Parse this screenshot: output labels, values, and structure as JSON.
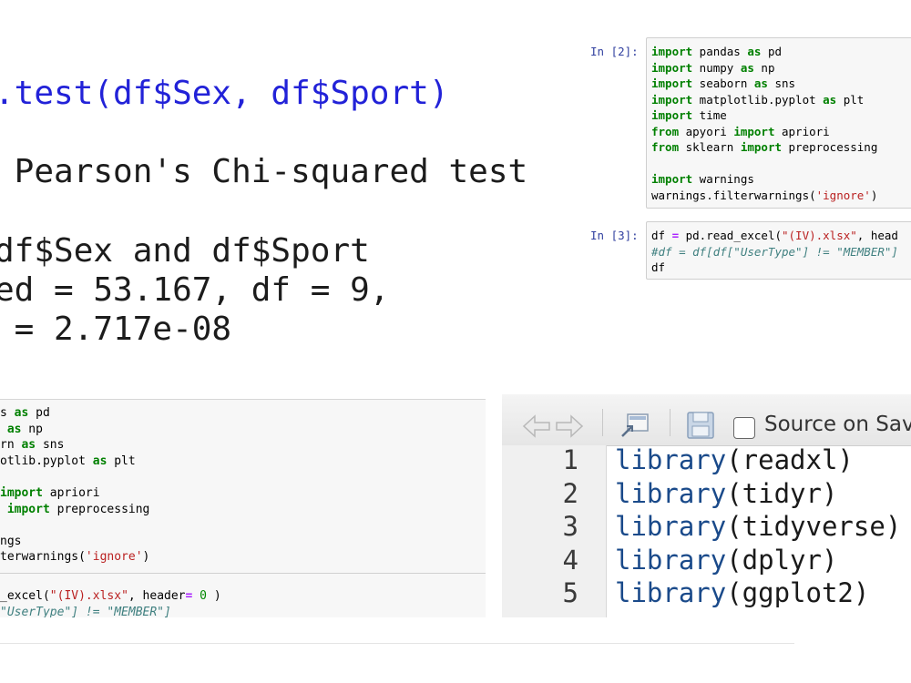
{
  "r_console": {
    "command": ".test(df$Sex, df$Sport)",
    "title": " Pearson's Chi-squared test",
    "data_line": "df$Sex and df$Sport",
    "stat_line": "ed = 53.167, df = 9,",
    "p_line": " = 2.717e-08"
  },
  "notebook_top": {
    "cell1_prompt": "In [2]:",
    "cell2_prompt": "In [3]:",
    "cell1_lines": [
      [
        [
          "kw",
          "import"
        ],
        [
          "t",
          " pandas "
        ],
        [
          "kw",
          "as"
        ],
        [
          "t",
          " pd"
        ]
      ],
      [
        [
          "kw",
          "import"
        ],
        [
          "t",
          " numpy "
        ],
        [
          "kw",
          "as"
        ],
        [
          "t",
          " np"
        ]
      ],
      [
        [
          "kw",
          "import"
        ],
        [
          "t",
          " seaborn "
        ],
        [
          "kw",
          "as"
        ],
        [
          "t",
          " sns"
        ]
      ],
      [
        [
          "kw",
          "import"
        ],
        [
          "t",
          " matplotlib.pyplot "
        ],
        [
          "kw",
          "as"
        ],
        [
          "t",
          " plt"
        ]
      ],
      [
        [
          "kw",
          "import"
        ],
        [
          "t",
          " time"
        ]
      ],
      [
        [
          "kw",
          "from"
        ],
        [
          "t",
          " apyori "
        ],
        [
          "kw",
          "import"
        ],
        [
          "t",
          " apriori"
        ]
      ],
      [
        [
          "kw",
          "from"
        ],
        [
          "t",
          " sklearn "
        ],
        [
          "kw",
          "import"
        ],
        [
          "t",
          " preprocessing"
        ]
      ],
      [
        [
          "t",
          ""
        ]
      ],
      [
        [
          "kw",
          "import"
        ],
        [
          "t",
          " warnings"
        ]
      ],
      [
        [
          "t",
          "warnings.filterwarnings("
        ],
        [
          "str",
          "'ignore'"
        ],
        [
          "t",
          ")"
        ]
      ]
    ],
    "cell2_lines": [
      [
        [
          "t",
          "df "
        ],
        [
          "op",
          "="
        ],
        [
          "t",
          " pd.read_excel("
        ],
        [
          "str",
          "\"(IV).xlsx\""
        ],
        [
          "t",
          ", head"
        ]
      ],
      [
        [
          "cmt",
          "#df = df[df[\"UserType\"] != \"MEMBER\"]"
        ]
      ],
      [
        [
          "t",
          "df"
        ]
      ]
    ]
  },
  "notebook_bottom": {
    "lines": [
      [
        [
          "t",
          "s "
        ],
        [
          "kw",
          "as"
        ],
        [
          "t",
          " pd"
        ]
      ],
      [
        [
          "t",
          " "
        ],
        [
          "kw",
          "as"
        ],
        [
          "t",
          " np"
        ]
      ],
      [
        [
          "t",
          "rn "
        ],
        [
          "kw",
          "as"
        ],
        [
          "t",
          " sns"
        ]
      ],
      [
        [
          "t",
          "otlib.pyplot "
        ],
        [
          "kw",
          "as"
        ],
        [
          "t",
          " plt"
        ]
      ],
      [
        [
          "t",
          ""
        ]
      ],
      [
        [
          "kw",
          "import"
        ],
        [
          "t",
          " apriori"
        ]
      ],
      [
        [
          "t",
          " "
        ],
        [
          "kw",
          "import"
        ],
        [
          "t",
          " preprocessing"
        ]
      ],
      [
        [
          "t",
          ""
        ]
      ],
      [
        [
          "t",
          "ngs"
        ]
      ],
      [
        [
          "t",
          "terwarnings("
        ],
        [
          "str",
          "'ignore'"
        ],
        [
          "t",
          ")"
        ]
      ]
    ],
    "lines2": [
      [
        [
          "t",
          "_excel("
        ],
        [
          "str",
          "\"(IV).xlsx\""
        ],
        [
          "t",
          ", header"
        ],
        [
          "op",
          "="
        ],
        [
          "t",
          " "
        ],
        [
          "num",
          "0"
        ],
        [
          "t",
          " )"
        ]
      ],
      [
        [
          "cmt",
          "\"UserType\"] != \"MEMBER\"]"
        ]
      ]
    ]
  },
  "rstudio": {
    "source_on_save_label": "Source on Save",
    "lines": [
      {
        "num": "1",
        "fn": "library",
        "arg": "readxl"
      },
      {
        "num": "2",
        "fn": "library",
        "arg": "tidyr"
      },
      {
        "num": "3",
        "fn": "library",
        "arg": "tidyverse"
      },
      {
        "num": "4",
        "fn": "library",
        "arg": "dplyr"
      },
      {
        "num": "5",
        "fn": "library",
        "arg": "ggplot2"
      }
    ]
  }
}
